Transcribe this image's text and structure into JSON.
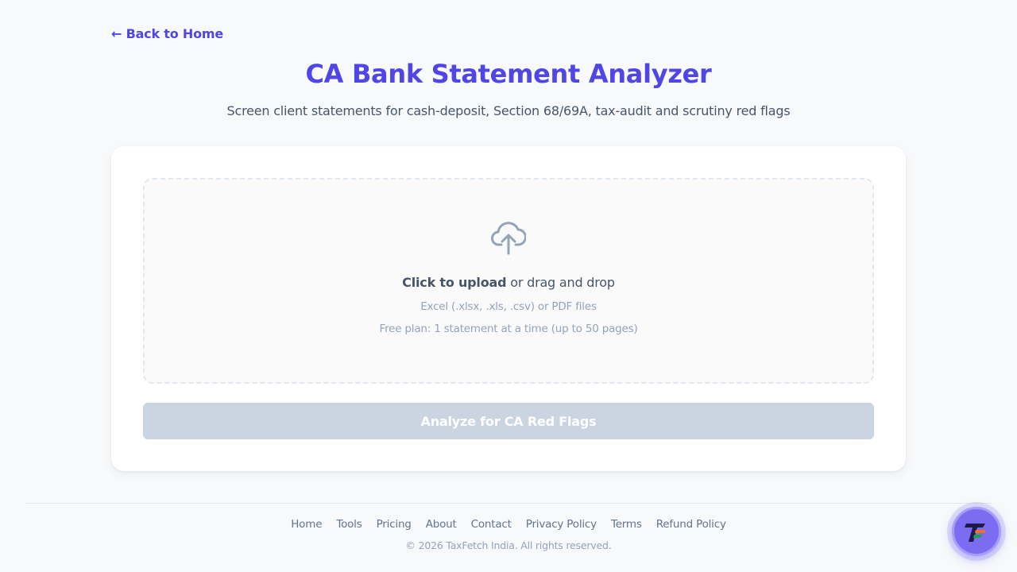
{
  "nav": {
    "back_link": "← Back to Home"
  },
  "header": {
    "title": "CA Bank Statement Analyzer",
    "subtitle": "Screen client statements for cash-deposit, Section 68/69A, tax-audit and scrutiny red flags"
  },
  "upload": {
    "icon": "cloud-upload-icon",
    "click_text": "Click to upload",
    "drag_text": " or drag and drop",
    "formats": "Excel (.xlsx, .xls, .csv) or PDF files",
    "plan_limit": "Free plan: 1 statement at a time (up to 50 pages)"
  },
  "actions": {
    "analyze_label": "Analyze for CA Red Flags"
  },
  "footer": {
    "links": [
      "Home",
      "Tools",
      "Pricing",
      "About",
      "Contact",
      "Privacy Policy",
      "Terms",
      "Refund Policy"
    ],
    "copyright": "© 2026 TaxFetch India. All rights reserved."
  },
  "chat": {
    "icon": "taxfetch-logo-icon"
  },
  "colors": {
    "accent": "#4f46e5",
    "button_disabled": "#cbd5e1",
    "page_bg": "#f8f9fb",
    "fab": "#7c6cf2"
  }
}
